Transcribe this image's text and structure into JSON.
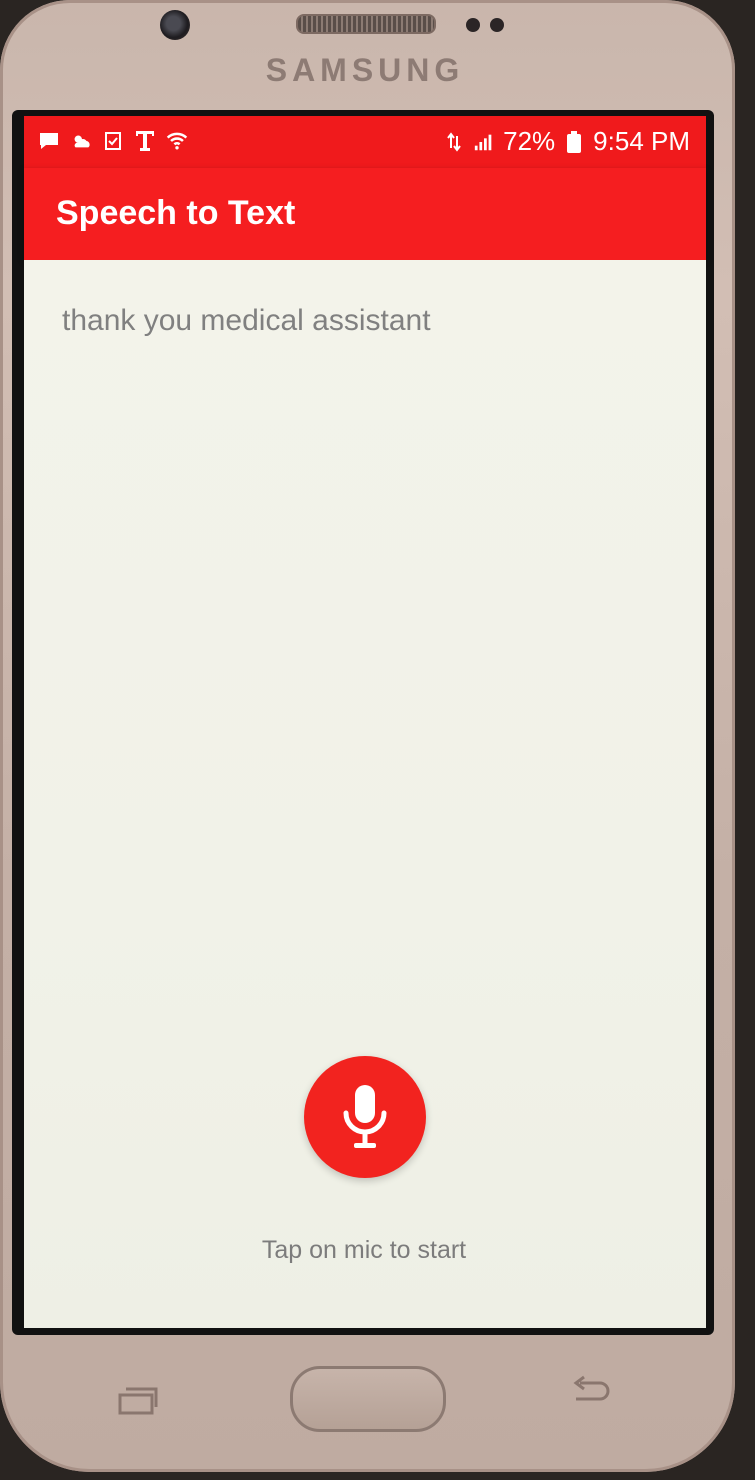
{
  "device": {
    "brand": "SAMSUNG"
  },
  "status_bar": {
    "battery": "72%",
    "time": "9:54 PM",
    "icons_left": [
      "message-icon",
      "weather-icon",
      "task-icon",
      "tmobile-icon",
      "wifi-icon"
    ],
    "icons_right": [
      "network-icon",
      "signal-icon",
      "battery-icon"
    ]
  },
  "toolbar": {
    "title": "Speech to Text"
  },
  "main": {
    "transcript": "thank you medical assistant",
    "hint": "Tap on mic to start",
    "mic_icon": "microphone-icon"
  },
  "colors": {
    "accent": "#f51e20",
    "status_bar": "#f01a1c",
    "background": "#f3f3ea"
  }
}
